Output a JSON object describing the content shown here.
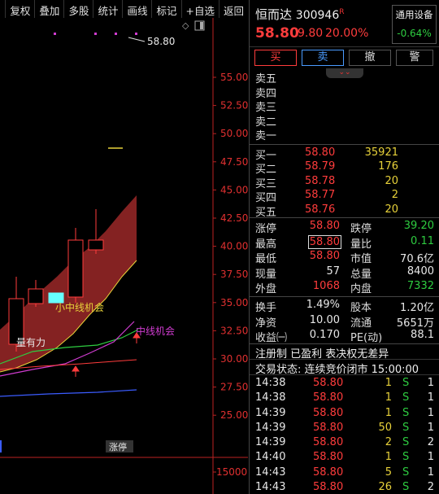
{
  "toolbar": {
    "buttons": [
      "复权",
      "叠加",
      "多股",
      "统计",
      "画线",
      "标记",
      "+自选",
      "返回"
    ]
  },
  "chart": {
    "price_ticks": [
      "55.00",
      "52.50",
      "50.00",
      "47.50",
      "45.00",
      "42.50",
      "40.00",
      "37.50",
      "35.00",
      "32.50",
      "30.00",
      "27.50",
      "25.00"
    ],
    "volume_tick": "15000",
    "high_label": "58.80",
    "annotations": [
      "小中线机会",
      "中线机会",
      "量有力"
    ],
    "bottom_label": "涨停"
  },
  "stock": {
    "name": "恒而达",
    "code": "300946",
    "badge": "R",
    "price": "58.80",
    "change": "9.80",
    "change_pct": "20.00%",
    "sector_name": "通用设备",
    "sector_pct": "-0.64%"
  },
  "trade_buttons": {
    "buy": "买",
    "sell": "卖",
    "cancel": "撤",
    "alert": "警"
  },
  "ask_labels": [
    "卖五",
    "卖四",
    "卖三",
    "卖二",
    "卖一"
  ],
  "bids": [
    {
      "label": "买一",
      "price": "58.80",
      "vol": "35921"
    },
    {
      "label": "买二",
      "price": "58.79",
      "vol": "176"
    },
    {
      "label": "买三",
      "price": "58.78",
      "vol": "20"
    },
    {
      "label": "买四",
      "price": "58.77",
      "vol": "2"
    },
    {
      "label": "买五",
      "price": "58.76",
      "vol": "20"
    }
  ],
  "stats": [
    {
      "l1": "涨停",
      "v1": "58.80",
      "l2": "跌停",
      "v2": "39.20"
    },
    {
      "l1": "最高",
      "v1": "58.80",
      "l2": "量比",
      "v2": "0.11"
    },
    {
      "l1": "最低",
      "v1": "58.80",
      "l2": "市值",
      "v2": "70.6亿"
    },
    {
      "l1": "现量",
      "v1": "57",
      "l2": "总量",
      "v2": "8400"
    },
    {
      "l1": "外盘",
      "v1": "1068",
      "l2": "内盘",
      "v2": "7332"
    }
  ],
  "stats2": [
    {
      "l1": "换手",
      "v1": "1.49%",
      "l2": "股本",
      "v2": "1.20亿"
    },
    {
      "l1": "净资",
      "v1": "10.00",
      "l2": "流通",
      "v2": "5651万"
    },
    {
      "l1": "收益㈠",
      "v1": "0.170",
      "l2": "PE(动)",
      "v2": "88.1"
    }
  ],
  "info": {
    "registration": "注册制 已盈利 表决权无差异",
    "status": "交易状态: 连续竞价闭市 15:00:00"
  },
  "trades": [
    {
      "time": "14:38",
      "price": "58.80",
      "vol": "1",
      "side": "S",
      "n": "1"
    },
    {
      "time": "14:38",
      "price": "58.80",
      "vol": "1",
      "side": "S",
      "n": "1"
    },
    {
      "time": "14:39",
      "price": "58.80",
      "vol": "1",
      "side": "S",
      "n": "1"
    },
    {
      "time": "14:39",
      "price": "58.80",
      "vol": "50",
      "side": "S",
      "n": "1"
    },
    {
      "time": "14:39",
      "price": "58.80",
      "vol": "2",
      "side": "S",
      "n": "2"
    },
    {
      "time": "14:40",
      "price": "58.80",
      "vol": "1",
      "side": "S",
      "n": "1"
    },
    {
      "time": "14:43",
      "price": "58.80",
      "vol": "5",
      "side": "S",
      "n": "1"
    },
    {
      "time": "14:43",
      "price": "58.80",
      "vol": "26",
      "side": "S",
      "n": "2"
    }
  ],
  "colors": {
    "up": "#ff3c3c",
    "down": "#2ecc40",
    "volume": "#e8d23a",
    "band_fill": "#8b2424"
  }
}
